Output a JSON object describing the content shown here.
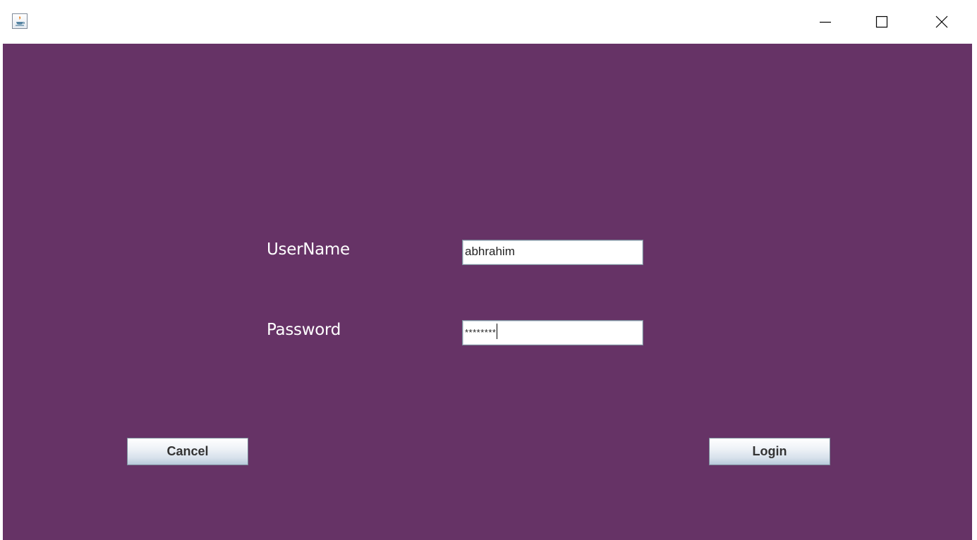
{
  "window": {
    "icon": "java-icon",
    "controls": {
      "minimize_icon": "minimize-icon",
      "maximize_icon": "maximize-icon",
      "close_icon": "close-icon"
    }
  },
  "form": {
    "background_color": "#663366",
    "username": {
      "label": "UserName",
      "value": "abhrahim"
    },
    "password": {
      "label": "Password",
      "masked_value": "********"
    }
  },
  "buttons": {
    "cancel_label": "Cancel",
    "login_label": "Login"
  }
}
